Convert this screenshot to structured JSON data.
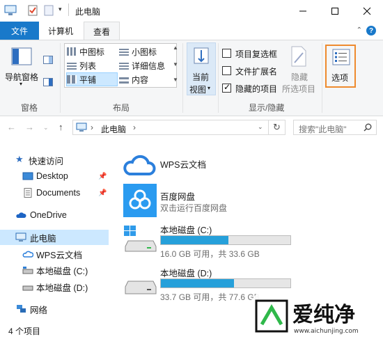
{
  "title_bar": {
    "title": "此电脑"
  },
  "tabs": {
    "file": "文件",
    "computer": "计算机",
    "view": "查看"
  },
  "ribbon": {
    "pane_group": {
      "nav_pane_label": "导航窗格",
      "group_label": "窗格"
    },
    "layout_group": {
      "items": [
        "中图标",
        "小图标",
        "列表",
        "详细信息",
        "平铺",
        "内容"
      ],
      "selected": "平铺",
      "group_label": "布局"
    },
    "current_view": {
      "label_line1": "当前",
      "label_line2": "视图"
    },
    "show_hide": {
      "item_checkboxes": {
        "label": "项目复选框",
        "checked": false
      },
      "file_extensions": {
        "label": "文件扩展名",
        "checked": false
      },
      "hidden_items": {
        "label": "隐藏的项目",
        "checked": true
      },
      "hide_selected_line1": "隐藏",
      "hide_selected_line2": "所选项目",
      "group_label": "显示/隐藏"
    },
    "options": {
      "label": "选项"
    }
  },
  "address_bar": {
    "location": "此电脑",
    "search_placeholder": "搜索\"此电脑\""
  },
  "nav_pane": {
    "quick_access": "快速访问",
    "desktop": "Desktop",
    "documents": "Documents",
    "onedrive": "OneDrive",
    "this_pc": "此电脑",
    "wps": "WPS云文档",
    "disk_c": "本地磁盘 (C:)",
    "disk_d": "本地磁盘 (D:)",
    "network": "网络"
  },
  "content": {
    "wps": {
      "title": "WPS云文档"
    },
    "baidu": {
      "title": "百度网盘",
      "subtitle": "双击运行百度网盘"
    },
    "disk_c": {
      "title": "本地磁盘 (C:)",
      "free": "16.0 GB 可用，共 33.6 GB",
      "used_fraction": 0.524
    },
    "disk_d": {
      "title": "本地磁盘 (D:)",
      "free": "33.7 GB 可用，共 77.6 GB",
      "used_fraction": 0.566
    }
  },
  "status": {
    "count": "4 个项目"
  },
  "watermark": {
    "text": "爱纯净",
    "url": "www.aichunjing.com"
  },
  "colors": {
    "accent": "#1979ca",
    "bar_fill": "#26a0da",
    "selection": "#cce8ff",
    "options_border": "#ee8a2e"
  }
}
